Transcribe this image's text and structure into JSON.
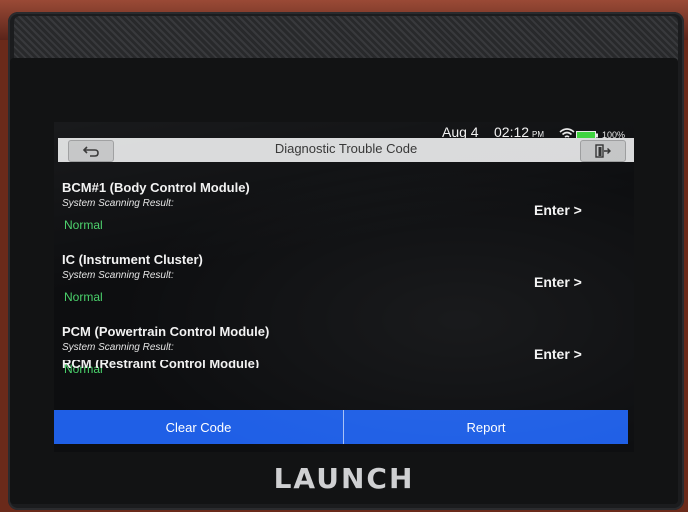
{
  "status": {
    "date": "Aug 4",
    "time": "02:12",
    "ampm": "PM",
    "battery": "100%"
  },
  "header": {
    "title": "Diagnostic Trouble Code"
  },
  "modules": [
    {
      "name": "BCM#1 (Body Control Module)",
      "result_label": "System Scanning Result:",
      "result": "Normal",
      "action": "Enter >"
    },
    {
      "name": "IC (Instrument Cluster)",
      "result_label": "System Scanning Result:",
      "result": "Normal",
      "action": "Enter >"
    },
    {
      "name": "PCM (Powertrain Control Module)",
      "result_label": "System Scanning Result:",
      "result": "Normal",
      "action": "Enter >"
    }
  ],
  "partial_module": {
    "name": "RCM (Restraint Control Module)"
  },
  "actions": {
    "clear_code": "Clear Code",
    "report": "Report"
  },
  "brand": {
    "logo_text": "LAUNCH"
  },
  "colors": {
    "accent": "#1f5fe6",
    "status_normal": "#4ad16b",
    "title_bar": "#d9dadb"
  }
}
